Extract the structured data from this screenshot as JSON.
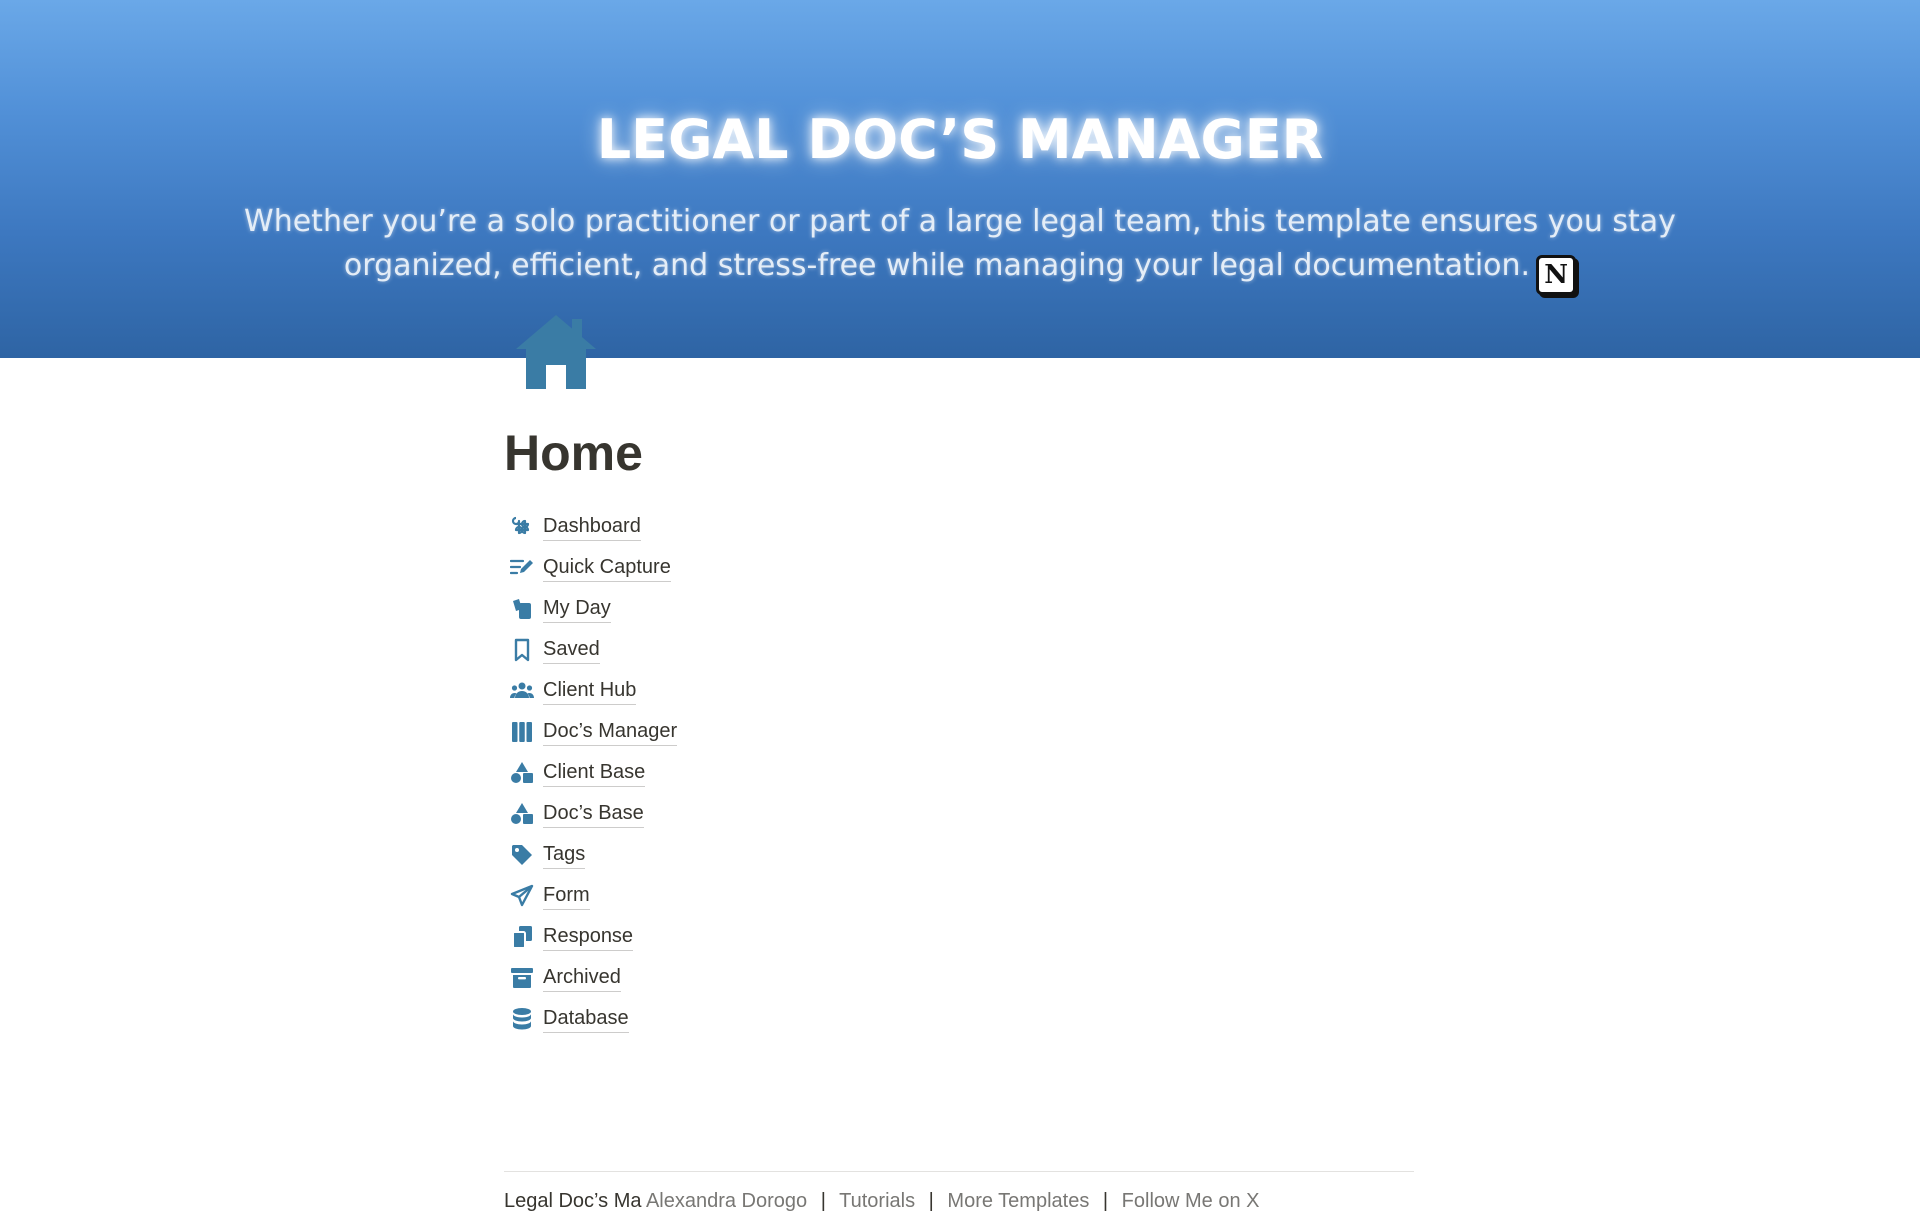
{
  "banner": {
    "title": "LEGAL DOC’S MANAGER",
    "subtitle": "Whether you’re a solo practitioner or part of a large legal team, this template ensures you stay organized, efficient, and stress-free while managing your legal documentation.",
    "badge_letter": "N",
    "gradient_top": "#6aa8e8",
    "gradient_bottom": "#2e64a4"
  },
  "page": {
    "icon": "home-icon",
    "title": "Home",
    "accent_color": "#3a7ca5"
  },
  "nav": {
    "items": [
      {
        "label": "Dashboard",
        "icon": "command-icon"
      },
      {
        "label": "Quick Capture",
        "icon": "pencil-lines-icon"
      },
      {
        "label": "My Day",
        "icon": "cards-icon"
      },
      {
        "label": "Saved",
        "icon": "bookmark-icon"
      },
      {
        "label": "Client Hub",
        "icon": "people-icon"
      },
      {
        "label": "Doc’s Manager",
        "icon": "columns-icon"
      },
      {
        "label": "Client Base",
        "icon": "shapes-icon"
      },
      {
        "label": "Doc’s Base",
        "icon": "shapes-icon"
      },
      {
        "label": "Tags",
        "icon": "tag-icon"
      },
      {
        "label": "Form",
        "icon": "paper-plane-icon"
      },
      {
        "label": "Response",
        "icon": "copy-icon"
      },
      {
        "label": "Archived",
        "icon": "archive-icon"
      },
      {
        "label": "Database",
        "icon": "database-icon"
      }
    ]
  },
  "footer": {
    "lead": "Legal Doc’s Ma",
    "lead_muted": "Alexandra Dorogo",
    "links": [
      "Tutorials",
      "More Templates",
      "Follow Me on X"
    ]
  }
}
